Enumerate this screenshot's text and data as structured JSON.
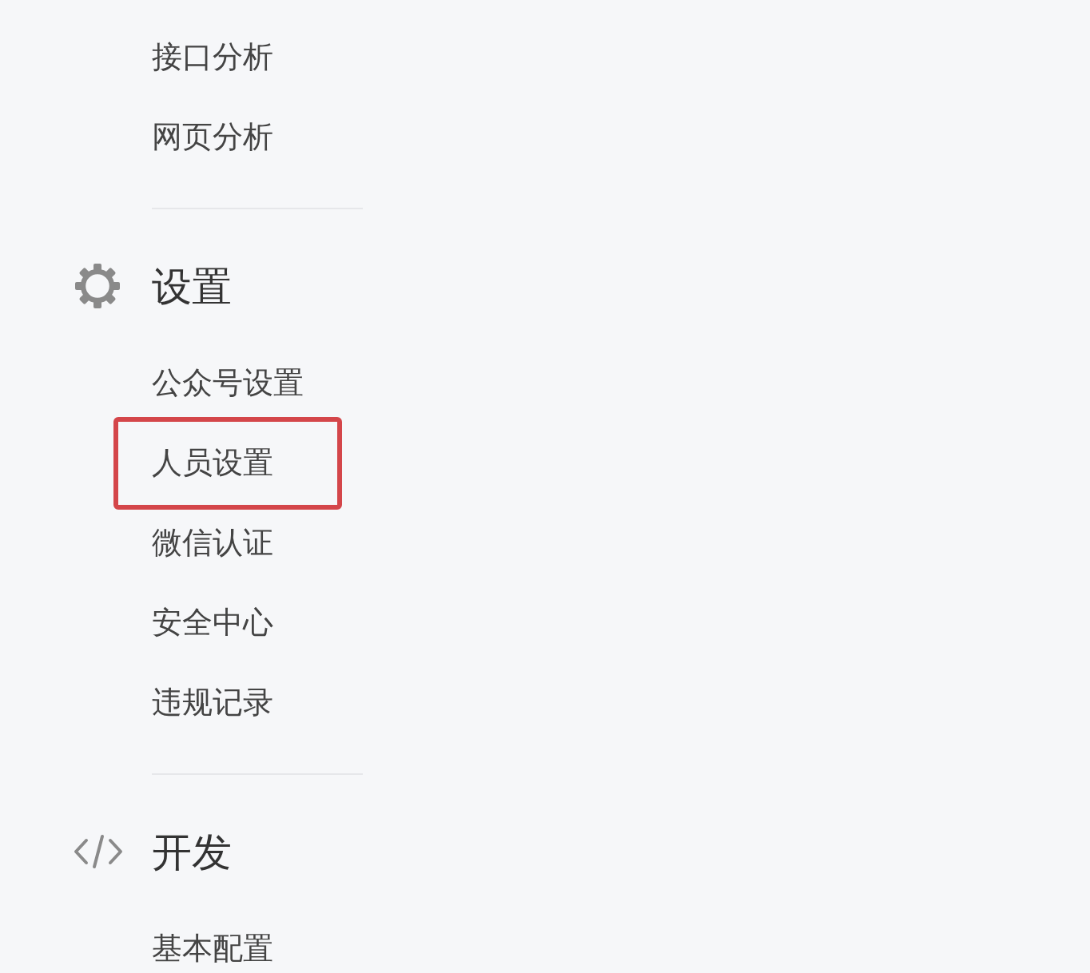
{
  "menu": {
    "top_items": [
      {
        "label": "接口分析",
        "highlighted": false
      },
      {
        "label": "网页分析",
        "highlighted": false
      }
    ],
    "sections": [
      {
        "kind": "gear",
        "title": "设置",
        "items": [
          {
            "label": "公众号设置",
            "highlighted": false
          },
          {
            "label": "人员设置",
            "highlighted": true
          },
          {
            "label": "微信认证",
            "highlighted": false
          },
          {
            "label": "安全中心",
            "highlighted": false
          },
          {
            "label": "违规记录",
            "highlighted": false
          }
        ]
      },
      {
        "kind": "code",
        "title": "开发",
        "items": [
          {
            "label": "基本配置",
            "highlighted": false
          }
        ]
      }
    ]
  }
}
